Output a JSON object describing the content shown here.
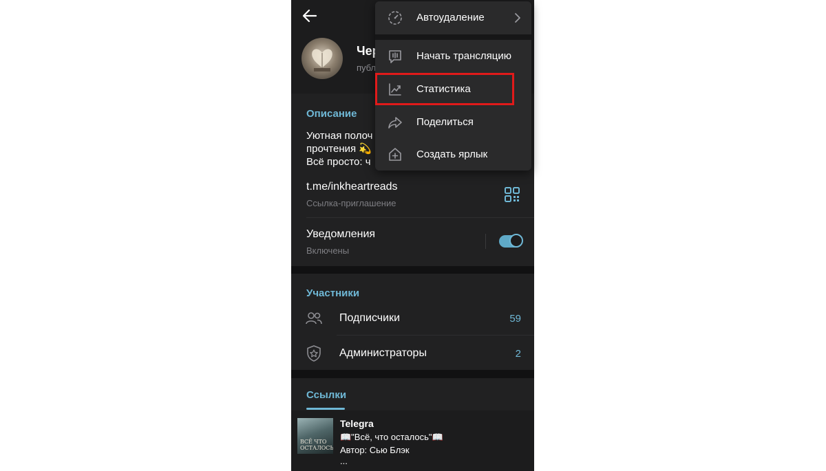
{
  "header": {
    "channel_title": "Чер",
    "channel_subtitle": "публ"
  },
  "description": {
    "section_title": "Описание",
    "lines": [
      "Уютная полоч",
      "прочтения 💫",
      "Всё просто: ч"
    ]
  },
  "invite_link": {
    "value": "t.me/inkheartreads",
    "label": "Ссылка-приглашение"
  },
  "notifications": {
    "label": "Уведомления",
    "status": "Включены",
    "enabled": true
  },
  "participants": {
    "section_title": "Участники",
    "rows": [
      {
        "label": "Подписчики",
        "count": "59",
        "icon": "people-icon"
      },
      {
        "label": "Администраторы",
        "count": "2",
        "icon": "shield-star-icon"
      }
    ]
  },
  "links_tab": {
    "label": "Ссылки"
  },
  "shared_item": {
    "title": "Telegra",
    "line1": "📖\"Всё, что осталось\"📖",
    "line2": "Автор: Сью Блэк",
    "line3": "...",
    "thumb_text": [
      "ВСЁ ЧТО",
      "ОСТАЛОСЬ"
    ]
  },
  "menu": {
    "items": [
      {
        "label": "Автоудаление",
        "icon": "timer-icon",
        "has_chevron": true
      },
      {
        "label": "Начать трансляцию",
        "icon": "broadcast-icon"
      },
      {
        "label": "Статистика",
        "icon": "chart-icon",
        "highlighted": true
      },
      {
        "label": "Поделиться",
        "icon": "share-icon"
      },
      {
        "label": "Создать ярлык",
        "icon": "add-shortcut-icon"
      }
    ]
  },
  "colors": {
    "accent": "#6fb8d6",
    "highlight": "#e11a1a",
    "background": "#1c1c1d"
  }
}
